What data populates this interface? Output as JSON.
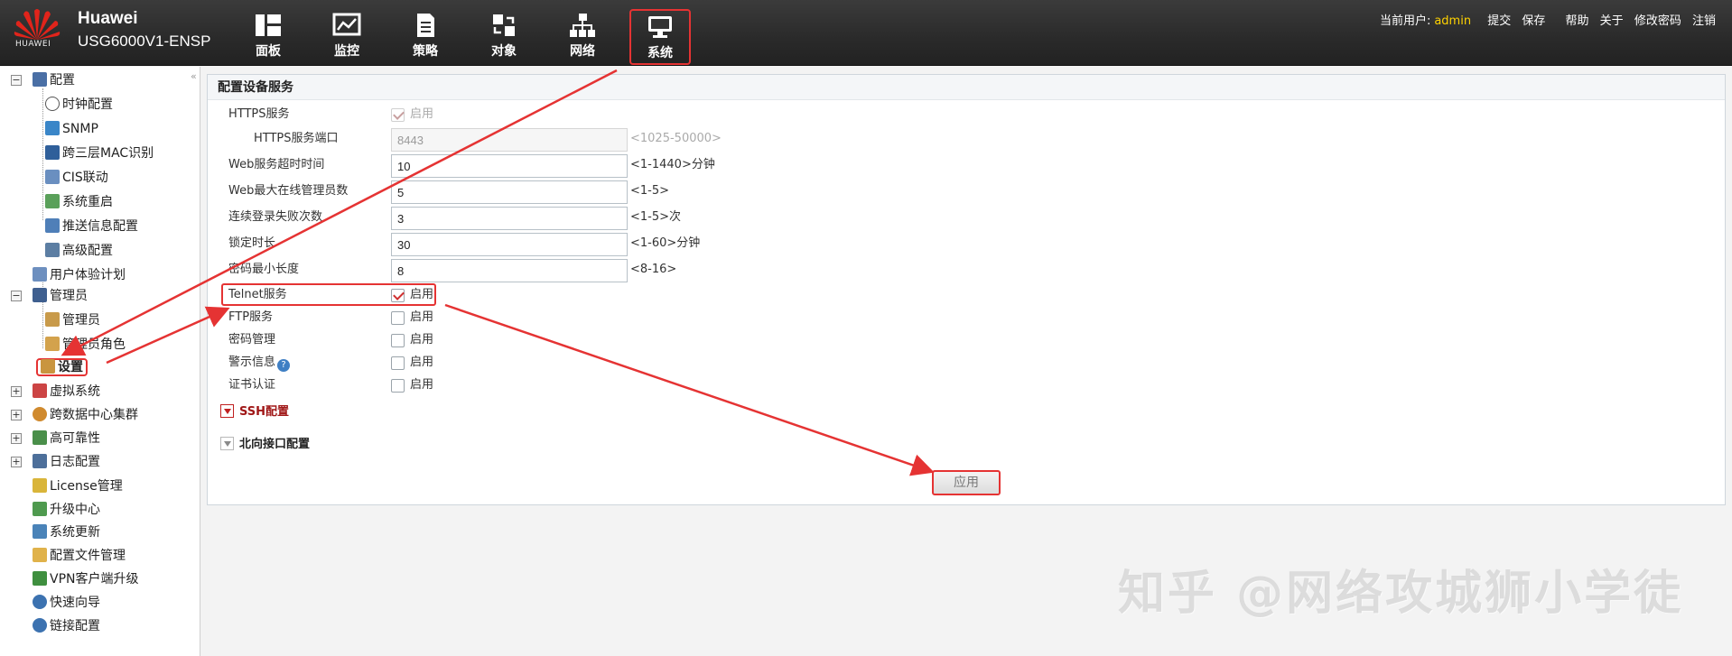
{
  "header": {
    "logo_text": "HUAWEI",
    "brand": "Huawei",
    "model": "USG6000V1-ENSP",
    "nav": [
      {
        "label": "面板",
        "icon": "dashboard-icon"
      },
      {
        "label": "监控",
        "icon": "monitor-icon"
      },
      {
        "label": "策略",
        "icon": "policy-icon"
      },
      {
        "label": "对象",
        "icon": "object-icon"
      },
      {
        "label": "网络",
        "icon": "network-icon"
      },
      {
        "label": "系统",
        "icon": "system-icon",
        "active": true
      }
    ],
    "user_label": "当前用户:",
    "username": "admin",
    "links": [
      "提交",
      "保存",
      "帮助",
      "关于",
      "修改密码",
      "注销"
    ]
  },
  "sidebar": {
    "items": [
      {
        "label": "配置",
        "level": 0,
        "expand": "-",
        "icon": "config-icon"
      },
      {
        "label": "时钟配置",
        "level": 1,
        "icon": "clock-icon"
      },
      {
        "label": "SNMP",
        "level": 1,
        "icon": "snmp-icon"
      },
      {
        "label": "跨三层MAC识别",
        "level": 1,
        "icon": "mac-icon"
      },
      {
        "label": "CIS联动",
        "level": 1,
        "icon": "cis-icon"
      },
      {
        "label": "系统重启",
        "level": 1,
        "icon": "restart-icon"
      },
      {
        "label": "推送信息配置",
        "level": 1,
        "icon": "push-icon"
      },
      {
        "label": "高级配置",
        "level": 1,
        "icon": "advanced-icon"
      },
      {
        "label": "用户体验计划",
        "level": 0,
        "icon": "experience-icon"
      },
      {
        "label": "管理员",
        "level": 0,
        "expand": "-",
        "icon": "admin-icon"
      },
      {
        "label": "管理员",
        "level": 1,
        "icon": "admin-user-icon"
      },
      {
        "label": "管理员角色",
        "level": 1,
        "icon": "admin-role-icon"
      },
      {
        "label": "设置",
        "level": 1,
        "icon": "settings-icon",
        "selected": true
      },
      {
        "label": "虚拟系统",
        "level": 0,
        "expand": "+",
        "icon": "vsys-icon"
      },
      {
        "label": "跨数据中心集群",
        "level": 0,
        "expand": "+",
        "icon": "cluster-icon"
      },
      {
        "label": "高可靠性",
        "level": 0,
        "expand": "+",
        "icon": "ha-icon"
      },
      {
        "label": "日志配置",
        "level": 0,
        "expand": "+",
        "icon": "log-icon"
      },
      {
        "label": "License管理",
        "level": 0,
        "icon": "license-icon"
      },
      {
        "label": "升级中心",
        "level": 0,
        "icon": "upgrade-icon"
      },
      {
        "label": "系统更新",
        "level": 0,
        "icon": "update-icon"
      },
      {
        "label": "配置文件管理",
        "level": 0,
        "icon": "config-file-icon"
      },
      {
        "label": "VPN客户端升级",
        "level": 0,
        "icon": "vpn-icon"
      },
      {
        "label": "快速向导",
        "level": 0,
        "icon": "wizard-icon"
      },
      {
        "label": "链接配置",
        "level": 0,
        "icon": "link-icon"
      }
    ]
  },
  "main": {
    "title": "配置设备服务",
    "https_service": {
      "label": "HTTPS服务",
      "check_label": "启用",
      "checked": true
    },
    "https_port": {
      "label": "HTTPS服务端口",
      "value": "8443",
      "hint": "<1025-50000>"
    },
    "web_timeout": {
      "label": "Web服务超时时间",
      "value": "10",
      "hint": "<1-1440>分钟"
    },
    "web_max_admins": {
      "label": "Web最大在线管理员数",
      "value": "5",
      "hint": "<1-5>"
    },
    "login_fail": {
      "label": "连续登录失败次数",
      "value": "3",
      "hint": "<1-5>次"
    },
    "lock_time": {
      "label": "锁定时长",
      "value": "30",
      "hint": "<1-60>分钟"
    },
    "pwd_min": {
      "label": "密码最小长度",
      "value": "8",
      "hint": "<8-16>"
    },
    "telnet": {
      "label": "Telnet服务",
      "check_label": "启用",
      "checked": true
    },
    "ftp": {
      "label": "FTP服务",
      "check_label": "启用",
      "checked": false
    },
    "pwd_mgmt": {
      "label": "密码管理",
      "check_label": "启用",
      "checked": false
    },
    "warning": {
      "label": "警示信息",
      "check_label": "启用",
      "checked": false
    },
    "cert_auth": {
      "label": "证书认证",
      "check_label": "启用",
      "checked": false
    },
    "ssh_section": "SSH配置",
    "north_section": "北向接口配置",
    "apply": "应用"
  },
  "watermark": "知乎 @网络攻城狮小学徒",
  "colors": {
    "accent_red": "#e53333",
    "admin_yellow": "#ffd200",
    "topbar": "#2f2f2f"
  }
}
